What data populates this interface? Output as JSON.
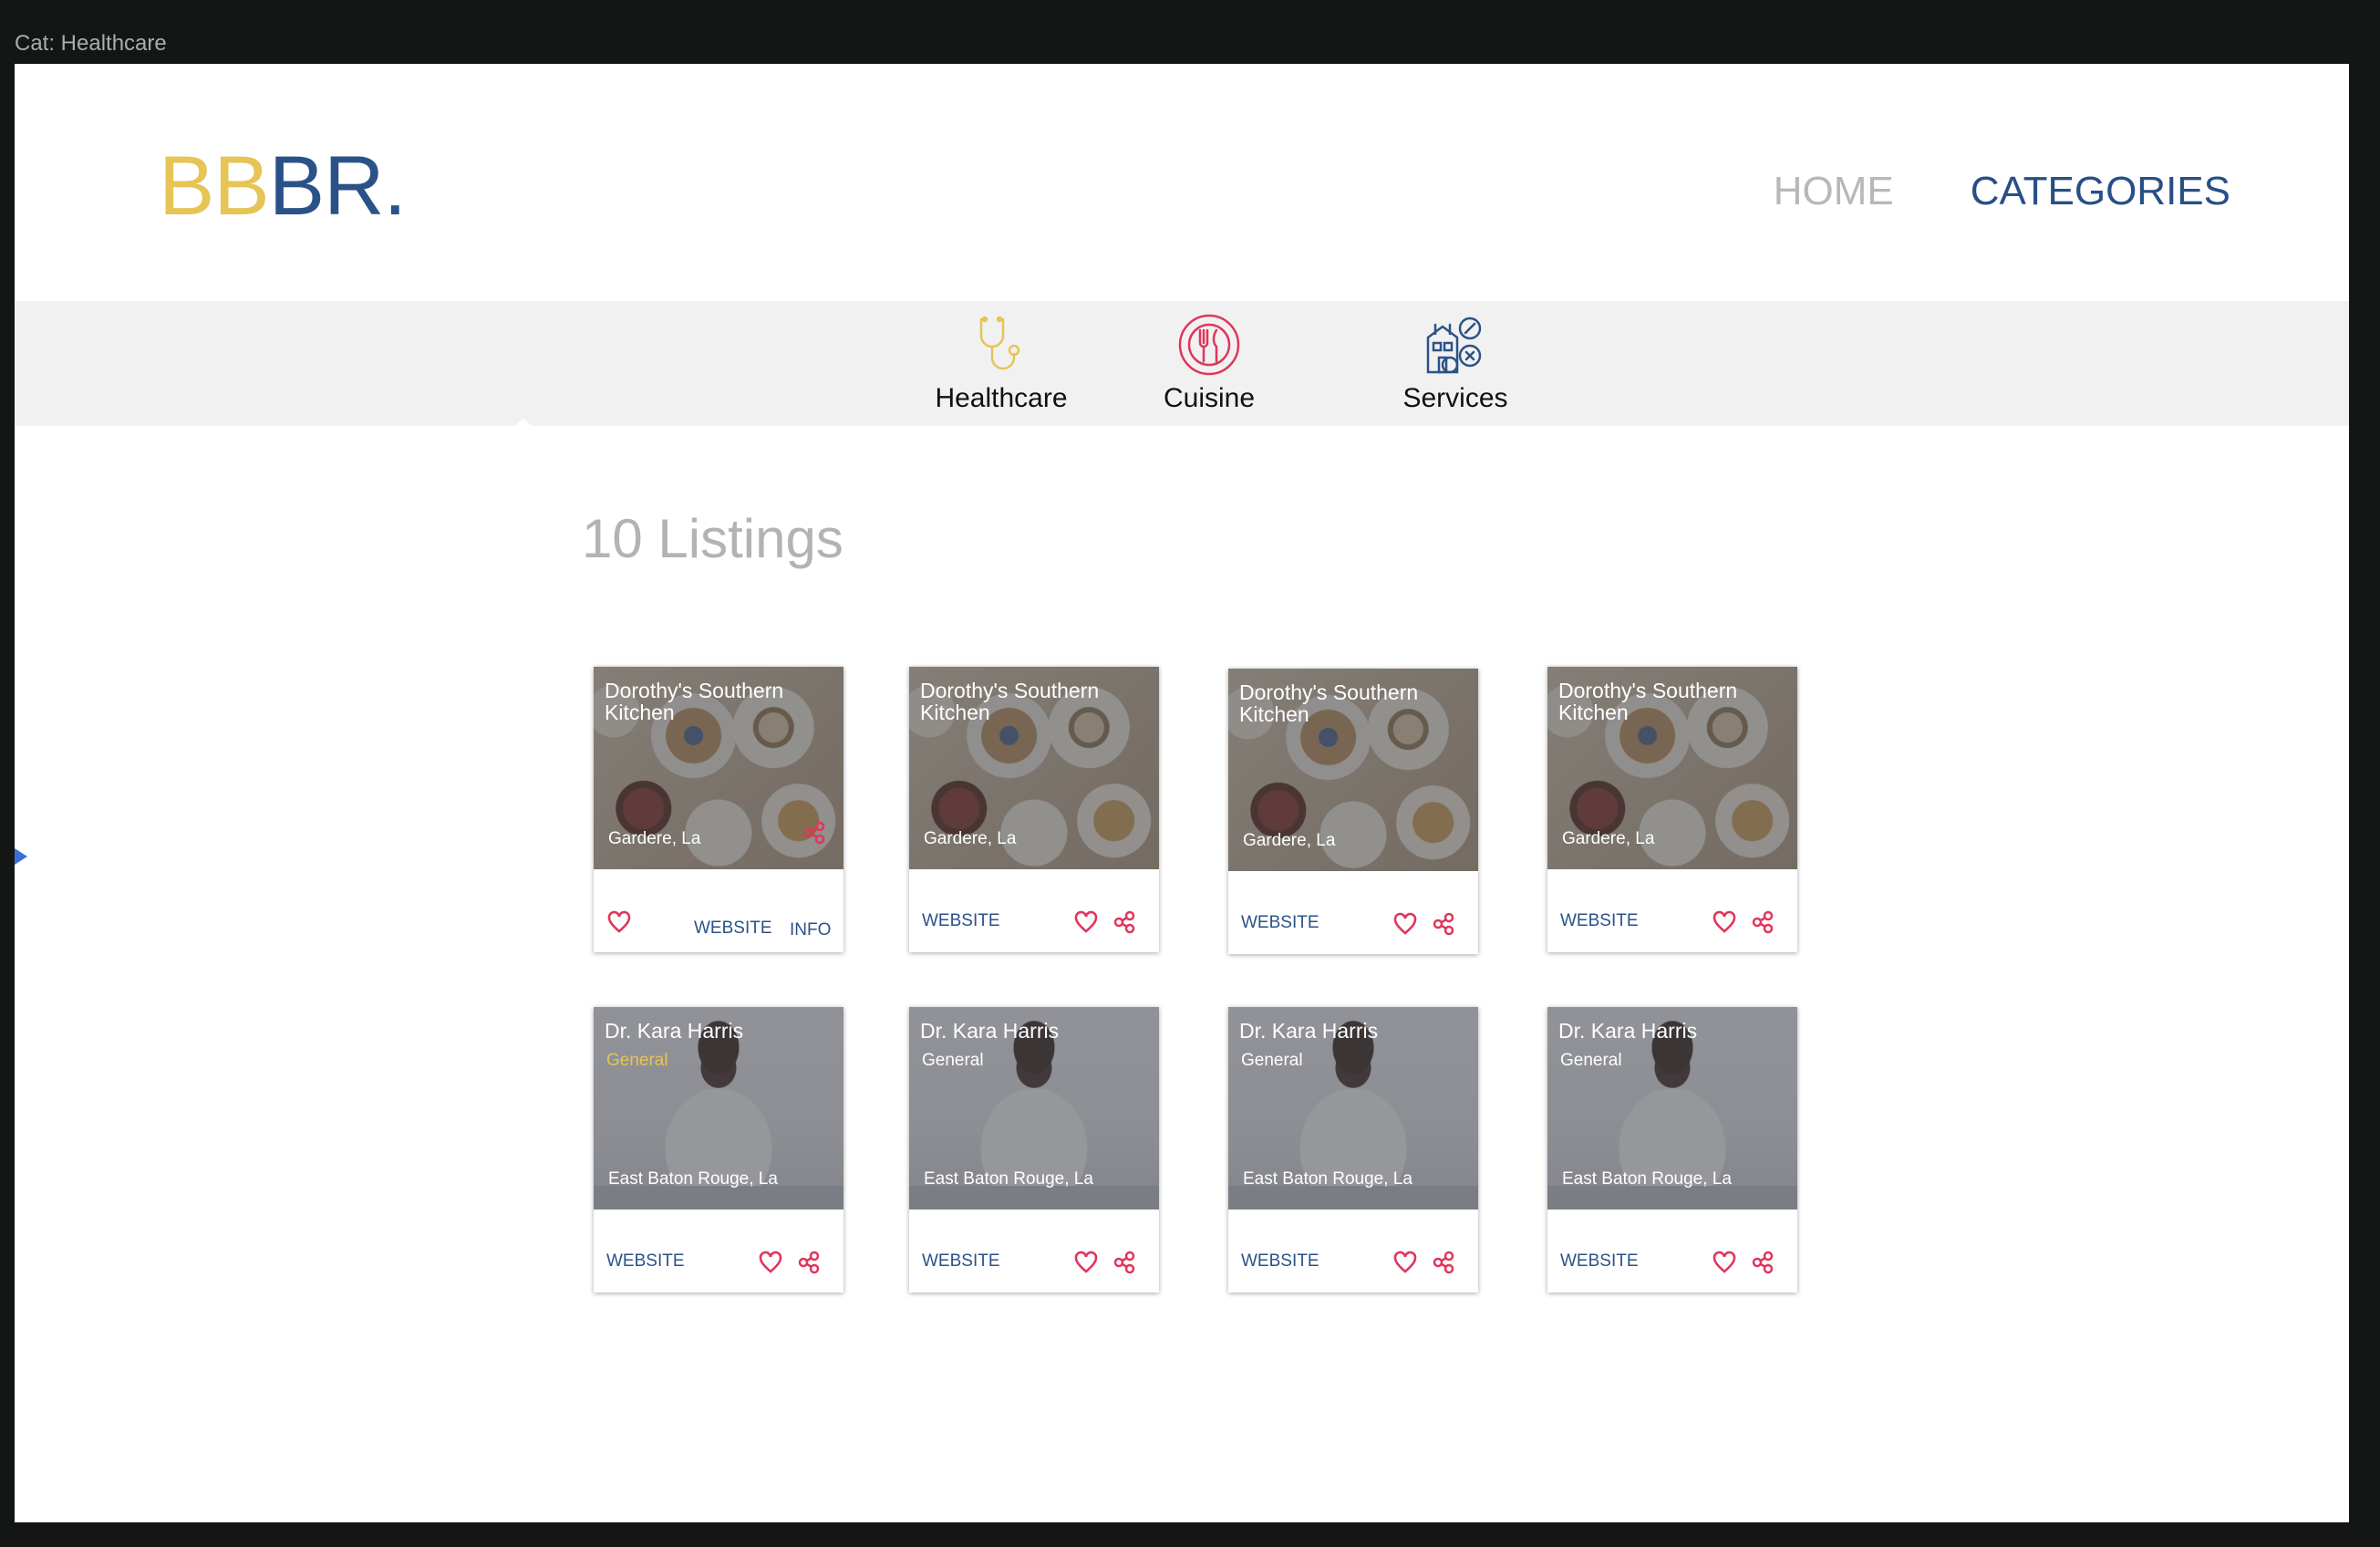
{
  "frame": {
    "title": "Cat: Healthcare"
  },
  "header": {
    "logo": {
      "part_yellow": "BB",
      "part_blue": "BR."
    },
    "nav": [
      {
        "label": "HOME"
      },
      {
        "label": "CATEGORIES"
      }
    ]
  },
  "categories": [
    {
      "label": "Healthcare",
      "icon": "stethoscope-icon"
    },
    {
      "label": "Cuisine",
      "icon": "fork-knife-icon"
    },
    {
      "label": "Services",
      "icon": "services-building-icon"
    }
  ],
  "listings": {
    "count_label": "10 Listings"
  },
  "cards": [
    {
      "title": "Dorothy's Southern Kitchen",
      "location": "Gardere, La",
      "website": "WEBSITE",
      "info": "INFO",
      "image": "food"
    },
    {
      "title": "Dorothy's Southern Kitchen",
      "location": "Gardere, La",
      "website": "WEBSITE",
      "image": "food"
    },
    {
      "title": "Dorothy's Southern Kitchen",
      "location": "Gardere, La",
      "website": "WEBSITE",
      "image": "food"
    },
    {
      "title": "Dorothy's Southern Kitchen",
      "location": "Gardere, La",
      "website": "WEBSITE",
      "image": "food"
    },
    {
      "title": "Dr. Kara Harris",
      "subtitle": "General",
      "location": "East Baton Rouge, La",
      "website": "WEBSITE",
      "image": "doctor"
    },
    {
      "title": "Dr. Kara Harris",
      "subtitle": "General",
      "location": "East Baton Rouge, La",
      "website": "WEBSITE",
      "image": "doctor"
    },
    {
      "title": "Dr. Kara Harris",
      "subtitle": "General",
      "location": "East Baton Rouge, La",
      "website": "WEBSITE",
      "image": "doctor"
    },
    {
      "title": "Dr. Kara Harris",
      "subtitle": "General",
      "location": "East Baton Rouge, La",
      "website": "WEBSITE",
      "image": "doctor"
    }
  ],
  "colors": {
    "brand_yellow": "#e6c455",
    "brand_blue": "#2b5288",
    "accent_red": "#e0365a",
    "nav_inactive": "#b8b8b8"
  }
}
